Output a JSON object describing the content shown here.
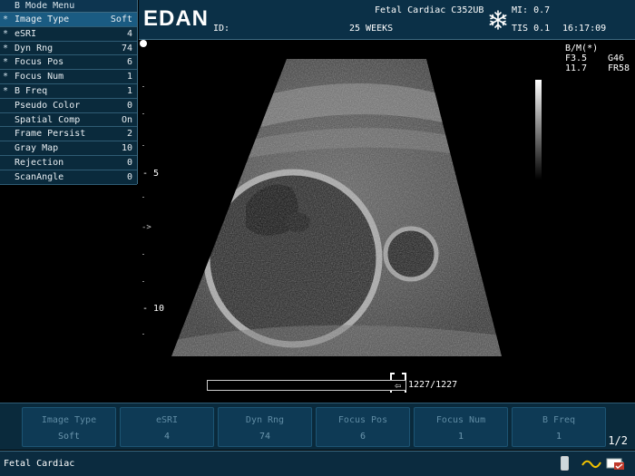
{
  "menu": {
    "title": "B Mode Menu",
    "items": [
      {
        "star": "*",
        "label": "Image Type",
        "value": "Soft",
        "active": true
      },
      {
        "star": "*",
        "label": "eSRI",
        "value": "4"
      },
      {
        "star": "*",
        "label": "Dyn Rng",
        "value": "74"
      },
      {
        "star": "*",
        "label": "Focus Pos",
        "value": "6"
      },
      {
        "star": "*",
        "label": "Focus Num",
        "value": "1"
      },
      {
        "star": "*",
        "label": "B Freq",
        "value": "1"
      },
      {
        "star": "",
        "label": "Pseudo Color",
        "value": "0"
      },
      {
        "star": "",
        "label": "Spatial Comp",
        "value": "On"
      },
      {
        "star": "",
        "label": "Frame Persist",
        "value": "2"
      },
      {
        "star": "",
        "label": "Gray Map",
        "value": "10"
      },
      {
        "star": "",
        "label": "Rejection",
        "value": "0"
      },
      {
        "star": "",
        "label": "ScanAngle",
        "value": "0"
      }
    ]
  },
  "header": {
    "logo": "EDAN",
    "id_label": "ID:",
    "exam_probe": "Fetal Cardiac C352UB",
    "weeks": "25 WEEKS",
    "mi": "MI: 0.7",
    "tis": "TIS 0.1",
    "time": "16:17:09",
    "freeze_icon": "snowflake-icon"
  },
  "right_info": {
    "mode": "B/M(*)",
    "freq": "F3.5",
    "gain": "G46",
    "depth": "11.7",
    "frame_rate": "FR58"
  },
  "depth_scale": {
    "label_5": "- 5",
    "label_10": "- 10",
    "focus_marker": "->"
  },
  "cine": {
    "handle": "⇦",
    "frame": "1227/1227",
    "progress": 1.0
  },
  "softkeys": [
    {
      "label": "Image Type",
      "value": "Soft"
    },
    {
      "label": "eSRI",
      "value": "4"
    },
    {
      "label": "Dyn Rng",
      "value": "74"
    },
    {
      "label": "Focus Pos",
      "value": "6"
    },
    {
      "label": "Focus Num",
      "value": "1"
    },
    {
      "label": "B Freq",
      "value": "1"
    }
  ],
  "page_indicator": "1/2",
  "status": {
    "exam": "Fetal Cardiac",
    "icons": [
      "usb-icon",
      "trackball-mode-icon",
      "battery-icon"
    ]
  },
  "colors": {
    "menu_bg": "#0a2a3c",
    "active_row": "#1a5b82",
    "softkey_text": "#5f8ba3"
  }
}
